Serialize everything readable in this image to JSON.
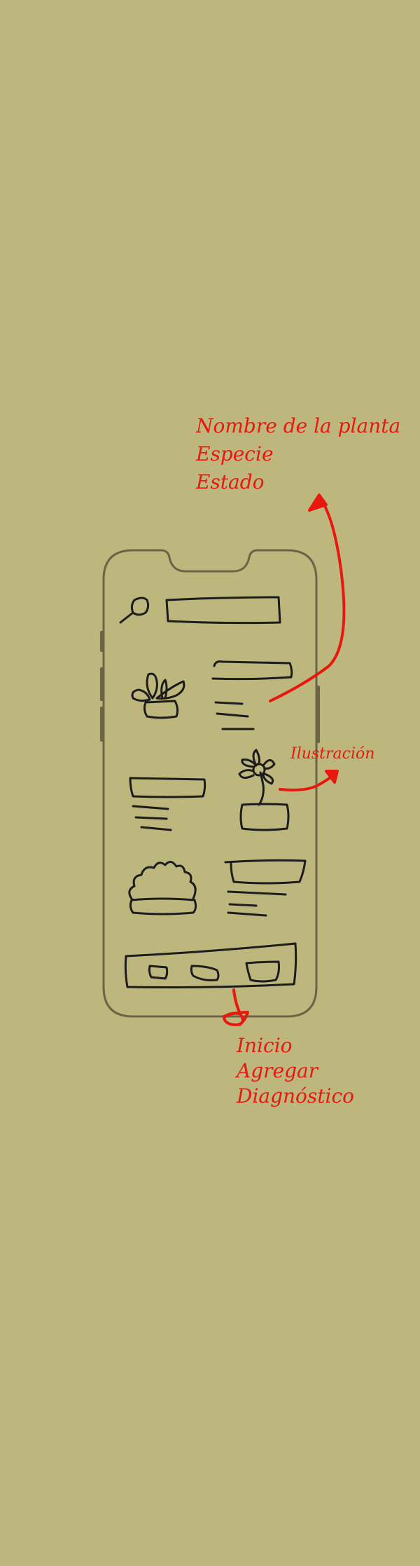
{
  "annotations": {
    "card_fields": [
      "Nombre de la planta",
      "Especie",
      "Estado"
    ],
    "illustration": "Ilustración",
    "nav_items": [
      "Inicio",
      "Agregar",
      "Diagnóstico"
    ]
  },
  "colors": {
    "background": "#bdb77e",
    "annotation": "#e8180f",
    "sketch_stroke": "#1c1c1c",
    "phone_frame": "#6b6446"
  },
  "icons": [
    "search-icon",
    "potted-plant-icon",
    "flower-pot-icon",
    "bush-pot-icon"
  ]
}
